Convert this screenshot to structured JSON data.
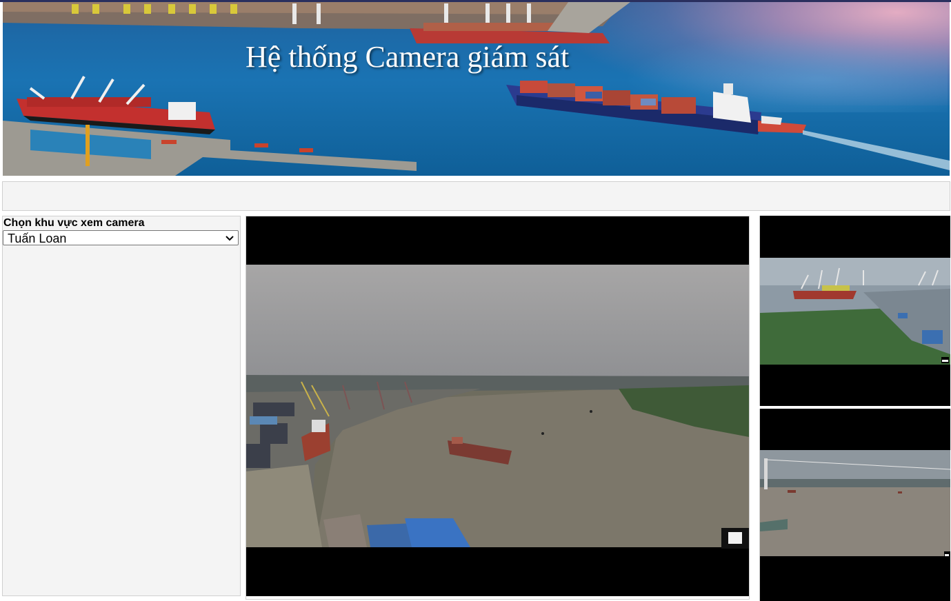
{
  "banner": {
    "title": "Hệ thống Camera giám sát"
  },
  "area_selector": {
    "label": "Chọn khu vực xem camera",
    "selected": "Tuấn Loan"
  },
  "colors": {
    "page_background": "#ffffff",
    "panel_background": "#f4f4f4",
    "video_background": "#000000"
  },
  "icons": {
    "dropdown": "chevron-down-icon",
    "fullscreen": "fullscreen-icon",
    "minimize": "minimize-icon"
  }
}
